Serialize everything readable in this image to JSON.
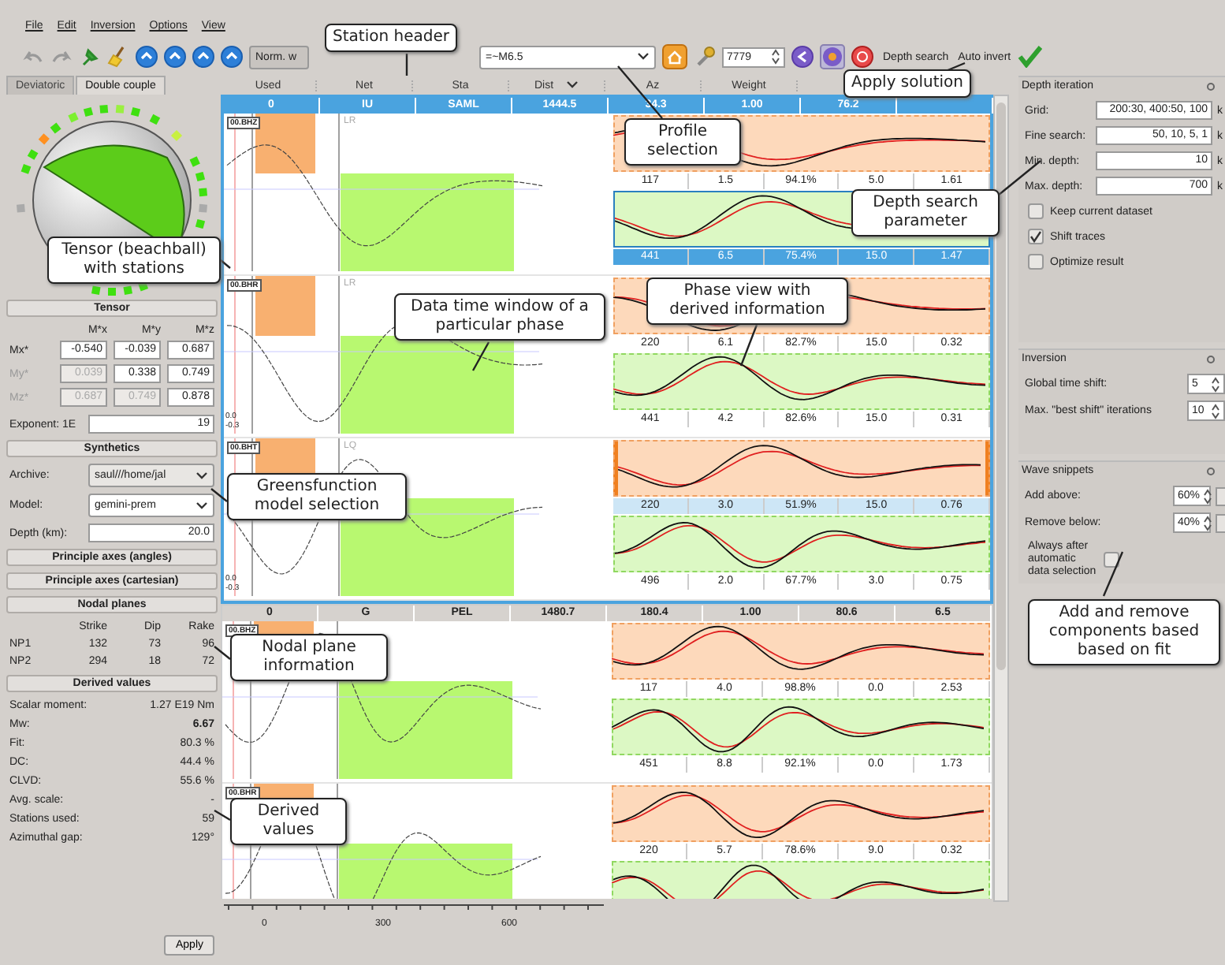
{
  "menu": [
    "File",
    "Edit",
    "Inversion",
    "Options",
    "View"
  ],
  "toolbar": {
    "norm_combo": "Norm. w",
    "profile_combo": "=~M6.5",
    "event_spin": "7779",
    "labels": [
      "Depth search",
      "Auto invert"
    ]
  },
  "left_panel": {
    "tabs": [
      {
        "label": "Deviatoric",
        "selected": false
      },
      {
        "label": "Double couple",
        "selected": true
      }
    ],
    "sections": [
      {
        "kind": "tensor",
        "title": "Tensor",
        "columns": [
          "M*x",
          "M*y",
          "M*z"
        ],
        "rows": [
          {
            "label": "Mx*",
            "disabled": false,
            "cells": [
              {
                "value": "-0.540",
                "disabled": false
              },
              {
                "value": "-0.039",
                "disabled": false
              },
              {
                "value": "0.687",
                "disabled": false
              }
            ]
          },
          {
            "label": "My*",
            "disabled": true,
            "cells": [
              {
                "value": "0.039",
                "disabled": true
              },
              {
                "value": "0.338",
                "disabled": false
              },
              {
                "value": "0.749",
                "disabled": false
              }
            ]
          },
          {
            "label": "Mz*",
            "disabled": true,
            "cells": [
              {
                "value": "0.687",
                "disabled": true
              },
              {
                "value": "0.749",
                "disabled": true
              },
              {
                "value": "0.878",
                "disabled": false
              }
            ]
          }
        ],
        "exponent_label": "Exponent: 1E",
        "exponent": "19"
      },
      {
        "kind": "synthetics",
        "title": "Synthetics",
        "archive_label": "Archive:",
        "archive": "saul///home/jal",
        "model_label": "Model:",
        "model": "gemini-prem",
        "depth_label": "Depth (km):",
        "depth": "20.0"
      },
      {
        "kind": "button",
        "title": "Principle axes (angles)"
      },
      {
        "kind": "button",
        "title": "Principle axes (cartesian)"
      },
      {
        "kind": "nodal",
        "title": "Nodal planes",
        "columns": [
          "Strike",
          "Dip",
          "Rake"
        ],
        "rows": [
          {
            "label": "NP1",
            "values": [
              "132",
              "73",
              "96"
            ]
          },
          {
            "label": "NP2",
            "values": [
              "294",
              "18",
              "72"
            ]
          }
        ]
      },
      {
        "kind": "derived",
        "title": "Derived values",
        "rows": [
          {
            "label": "Scalar moment:",
            "value": "1.27 E19 Nm",
            "bold": false
          },
          {
            "label": "Mw:",
            "value": "6.67",
            "bold": true
          },
          {
            "label": "Fit:",
            "value": "80.3 %",
            "bold": false
          },
          {
            "label": "DC:",
            "value": "44.4 %",
            "bold": false
          },
          {
            "label": "CLVD:",
            "value": "55.6 %",
            "bold": false
          },
          {
            "label": "Avg. scale:",
            "value": "-",
            "bold": false
          },
          {
            "label": "Stations used:",
            "value": "59",
            "bold": false
          },
          {
            "label": "Azimuthal gap:",
            "value": "129°",
            "bold": false
          }
        ]
      }
    ],
    "apply_button": "Apply"
  },
  "table": {
    "columns": [
      "Used",
      "Net",
      "Sta",
      "Dist",
      "Az",
      "Weight"
    ],
    "stations": [
      {
        "selected": true,
        "values": [
          "0",
          "IU",
          "SAML",
          "1444.5",
          "34.3",
          "1.00",
          "76.2"
        ],
        "components": [
          {
            "channel": "00.BHZ",
            "marker": "LR",
            "phases": [
              {
                "kind": "body",
                "selected": false,
                "active": false,
                "values": [
                  "117",
                  "1.5",
                  "94.1%",
                  "5.0",
                  "1.61"
                ]
              },
              {
                "kind": "surface",
                "selected": true,
                "active": false,
                "values": [
                  "441",
                  "6.5",
                  "75.4%",
                  "15.0",
                  "1.47"
                ]
              }
            ]
          },
          {
            "channel": "00.BHR",
            "marker": "LR",
            "amp_labels": [
              "0.0",
              "-0.3"
            ],
            "phases": [
              {
                "kind": "body",
                "selected": false,
                "active": false,
                "values": [
                  "220",
                  "6.1",
                  "82.7%",
                  "15.0",
                  "0.32"
                ]
              },
              {
                "kind": "surface",
                "selected": false,
                "active": false,
                "values": [
                  "441",
                  "4.2",
                  "82.6%",
                  "15.0",
                  "0.31"
                ]
              }
            ]
          },
          {
            "channel": "00.BHT",
            "marker": "LQ",
            "amp_labels": [
              "0.0",
              "-0.3"
            ],
            "phases": [
              {
                "kind": "body",
                "selected": false,
                "active": true,
                "values": [
                  "220",
                  "3.0",
                  "51.9%",
                  "15.0",
                  "0.76"
                ]
              },
              {
                "kind": "surface",
                "selected": false,
                "active": false,
                "values": [
                  "496",
                  "2.0",
                  "67.7%",
                  "3.0",
                  "0.75"
                ]
              }
            ]
          }
        ]
      },
      {
        "selected": false,
        "values": [
          "0",
          "G",
          "PEL",
          "1480.7",
          "180.4",
          "1.00",
          "80.6",
          "6.5"
        ],
        "components": [
          {
            "channel": "00.BHZ",
            "phases": [
              {
                "kind": "body",
                "selected": false,
                "active": false,
                "values": [
                  "117",
                  "4.0",
                  "98.8%",
                  "0.0",
                  "2.53"
                ]
              },
              {
                "kind": "surface",
                "selected": false,
                "active": false,
                "values": [
                  "451",
                  "8.8",
                  "92.1%",
                  "0.0",
                  "1.73"
                ]
              }
            ]
          },
          {
            "channel": "00.BHR",
            "phases": [
              {
                "kind": "body",
                "selected": false,
                "active": false,
                "values": [
                  "220",
                  "5.7",
                  "78.6%",
                  "9.0",
                  "0.32"
                ]
              },
              {
                "kind": "surface",
                "selected": false,
                "active": false
              }
            ]
          }
        ]
      }
    ],
    "axis_ticks": [
      "0",
      "300",
      "600"
    ]
  },
  "right_panel": {
    "depth_iteration": {
      "title": "Depth iteration",
      "fields": [
        {
          "label": "Grid:",
          "value": "200:30, 400:50, 100",
          "unit": "k"
        },
        {
          "label": "Fine search:",
          "value": "50, 10, 5, 1",
          "unit": "k"
        },
        {
          "label": "Min. depth:",
          "value": "10",
          "unit": "k"
        },
        {
          "label": "Max. depth:",
          "value": "700",
          "unit": "k"
        }
      ],
      "checkboxes": [
        {
          "label": "Keep current dataset",
          "checked": false
        },
        {
          "label": "Shift traces",
          "checked": true
        },
        {
          "label": "Optimize result",
          "checked": false
        }
      ]
    },
    "inversion": {
      "title": "Inversion",
      "spins": [
        {
          "label": "Global time shift:",
          "value": "5"
        },
        {
          "label": "Max. \"best shift\" iterations",
          "value": "10"
        }
      ]
    },
    "wave_snippets": {
      "title": "Wave snippets",
      "spins": [
        {
          "label": "Add above:",
          "value": "60%"
        },
        {
          "label": "Remove below:",
          "value": "40%"
        }
      ],
      "checkbox": {
        "label": "Always after automatic data selection",
        "checked": false
      }
    }
  },
  "callouts": [
    {
      "text": "Station header"
    },
    {
      "text": "Profile selection"
    },
    {
      "text": "Apply solution"
    },
    {
      "text": "Depth search parameter"
    },
    {
      "text": "Tensor (beachball) with stations"
    },
    {
      "text": "Data time window of a particular phase"
    },
    {
      "text": "Phase view with derived information"
    },
    {
      "text": "Greensfunction model selection"
    },
    {
      "text": "Nodal plane information"
    },
    {
      "text": "Derived values"
    },
    {
      "text": "Add and remove components based based on fit"
    }
  ]
}
